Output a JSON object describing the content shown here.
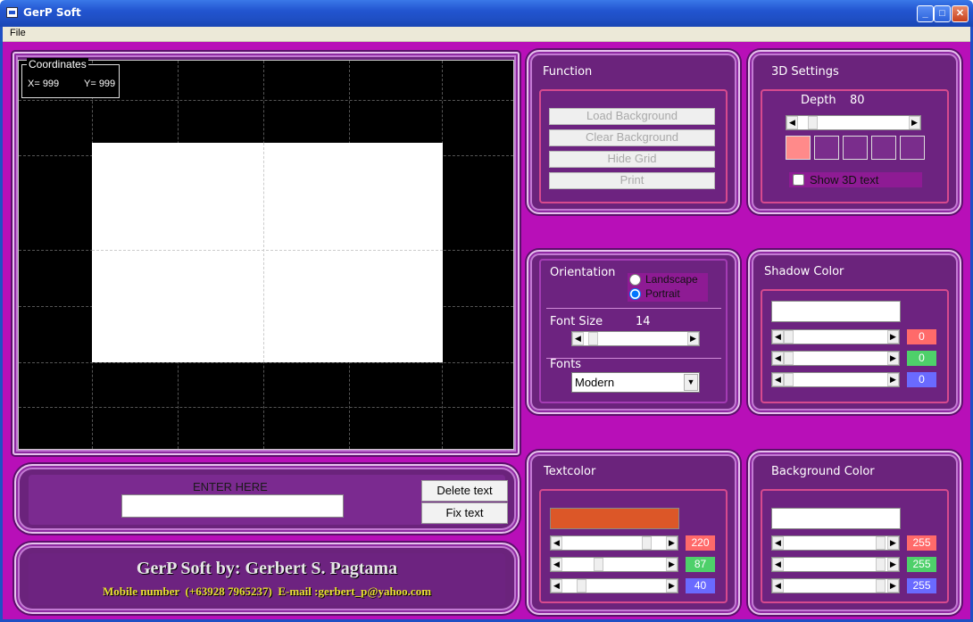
{
  "window": {
    "title": "GerP Soft",
    "minimize": "_",
    "maximize": "□",
    "close": "✕"
  },
  "menu": {
    "file": "File"
  },
  "coordinates": {
    "legend": "Coordinates",
    "x": "X= 999",
    "y": "Y= 999"
  },
  "entry": {
    "label": "ENTER HERE",
    "value": "",
    "delete_btn": "Delete text",
    "fix_btn": "Fix text"
  },
  "footer": {
    "title": "GerP Soft by: Gerbert S. Pagtama",
    "contact": "Mobile number  (+63928 7965237)  E-mail :gerbert_p@yahoo.com"
  },
  "function": {
    "title": "Function",
    "buttons": [
      "Load Background",
      "Clear Background",
      "Hide Grid",
      "Print"
    ]
  },
  "settings3d": {
    "title": "3D Settings",
    "depth_label": "Depth",
    "depth_value": "80",
    "depth_fraction": 0.1,
    "show3d_label": "Show 3D text",
    "swatch_active": "#ff8a8a"
  },
  "orientation": {
    "title": "Orientation",
    "landscape": "Landscape",
    "portrait": "Portrait",
    "selected": "Portrait",
    "fontsize_label": "Font Size",
    "fontsize_value": "14",
    "fontsize_fraction": 0.05,
    "fonts_label": "Fonts",
    "font_selected": "Modern"
  },
  "shadow": {
    "title": "Shadow Color",
    "r": "0",
    "g": "0",
    "b": "0",
    "preview_color": "#ffffff"
  },
  "textcolor": {
    "title": "Textcolor",
    "r": "220",
    "g": "87",
    "b": "40",
    "preview_color": "#dc5728"
  },
  "background": {
    "title": "Background Color",
    "r": "255",
    "g": "255",
    "b": "255",
    "preview_color": "#ffffff"
  },
  "colors": {
    "red_box": "#ff6a6a",
    "green_box": "#4ed06a",
    "blue_box": "#6a6aff"
  }
}
